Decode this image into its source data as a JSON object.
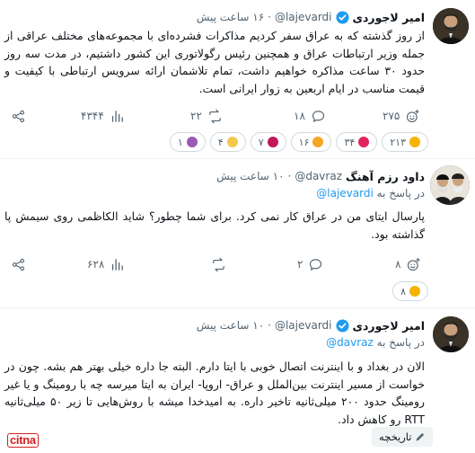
{
  "posts": [
    {
      "author": "امیر لاجوردی",
      "handle": "@lajevardi",
      "time": "۱۶ ساعت پیش",
      "text": "از روز گذشته که به عراق سفر کردیم مذاکرات فشرده‌ای با مجموعه‌های مختلف عراقی از جمله وزیر ارتباطات عراق و همچنین رئیس رگولاتوری این کشور داشتیم، در مدت سه روز حدود ۳۰ ساعت مذاکره خواهیم داشت، تمام تلاشمان ارائه سرویس ارتباطی با کیفیت و قیمت مناسب در ایام اربعین به زوار ایرانی است.",
      "stats": {
        "reply": "۲۷۵",
        "repost": "۱۸",
        "like": "۲۲",
        "views": "۴۳۴۴"
      },
      "reactions": [
        {
          "icon": "laugh-emoji-icon",
          "count": "۲۱۳",
          "color": "#f4b400"
        },
        {
          "icon": "heart-emoji-icon",
          "count": "۳۴",
          "color": "#e0245e"
        },
        {
          "icon": "thumbs-up-emoji-icon",
          "count": "۱۶",
          "color": "#f5a623"
        },
        {
          "icon": "rose-emoji-icon",
          "count": "۷",
          "color": "#c2185b"
        },
        {
          "icon": "praying-emoji-icon",
          "count": "۴",
          "color": "#f2c94c"
        },
        {
          "icon": "scream-emoji-icon",
          "count": "۱",
          "color": "#9b59b6"
        }
      ]
    },
    {
      "author": "داود رزم آهنگ",
      "handle": "@davraz",
      "time": "۱۰ ساعت پیش",
      "reply_prefix": "در پاسخ به",
      "reply_to": "@lajevardi",
      "text": "پارسال ایتای من در عراق کار نمی کرد. برای شما چطور؟ شاید الکاظمی روی سیمش پا گذاشته بود.",
      "stats": {
        "reply": "۸",
        "repost": "۲",
        "like": "",
        "views": "۶۲۸"
      },
      "reactions": [
        {
          "icon": "laugh-emoji-icon",
          "count": "۸",
          "color": "#f4b400"
        }
      ]
    },
    {
      "author": "امیر لاجوردی",
      "handle": "@lajevardi",
      "time": "۱۰ ساعت پیش",
      "reply_prefix": "در پاسخ به",
      "reply_to": "@davraz",
      "text": "الان در بغداد و با اینترنت اتصال خوبی با ایتا دارم. البته جا داره خیلی بهتر هم بشه. چون در خواست از مسیر اینترنت بین‌الملل و عراق- اروپا- ایران به ایتا میرسه چه با رومینگ و یا غیر رومینگ حدود ۲۰۰ میلی‌ثانیه تاخیر داره. به امیدخدا میشه با روش‌هایی تا زیر ۵۰ میلی‌ثانیه RTT رو کاهش داد.",
      "history_label": "تاریخچه"
    }
  ],
  "watermark": "citna"
}
